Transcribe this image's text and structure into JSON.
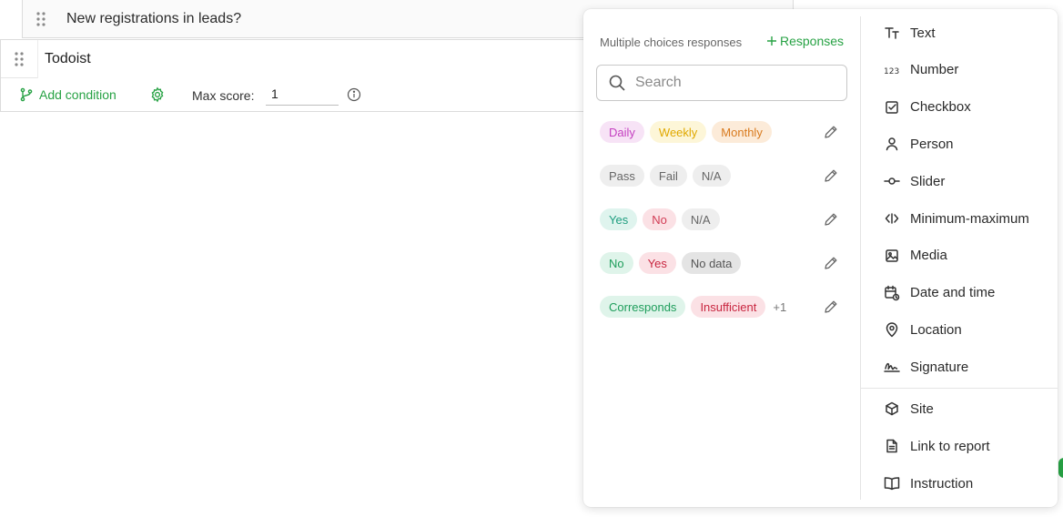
{
  "editor": {
    "previous_question": "New registrations in leads?",
    "current_question": "Todoist",
    "add_condition_label": "Add condition",
    "max_score_label": "Max score:",
    "max_score_value": "1"
  },
  "popover": {
    "header": "Multiple choices responses",
    "add_responses_label": "Responses",
    "search_placeholder": "Search",
    "response_sets": [
      {
        "chips": [
          {
            "label": "Daily",
            "bg": "#f7e3f6",
            "fg": "#c43fc0"
          },
          {
            "label": "Weekly",
            "bg": "#fdf6d8",
            "fg": "#e0a800"
          },
          {
            "label": "Monthly",
            "bg": "#fcebd9",
            "fg": "#d87a1e"
          }
        ],
        "more": ""
      },
      {
        "chips": [
          {
            "label": "Pass",
            "bg": "#eeeeee",
            "fg": "#666666"
          },
          {
            "label": "Fail",
            "bg": "#eeeeee",
            "fg": "#666666"
          },
          {
            "label": "N/A",
            "bg": "#eeeeee",
            "fg": "#666666"
          }
        ],
        "more": ""
      },
      {
        "chips": [
          {
            "label": "Yes",
            "bg": "#dff4ee",
            "fg": "#1f9e80"
          },
          {
            "label": "No",
            "bg": "#fbe1e5",
            "fg": "#d23c55"
          },
          {
            "label": "N/A",
            "bg": "#eeeeee",
            "fg": "#666666"
          }
        ],
        "more": ""
      },
      {
        "chips": [
          {
            "label": "No",
            "bg": "#dff4ea",
            "fg": "#1f9e5c"
          },
          {
            "label": "Yes",
            "bg": "#fbe1e5",
            "fg": "#c8253f"
          },
          {
            "label": "No data",
            "bg": "#e4e4e4",
            "fg": "#555555"
          }
        ],
        "more": ""
      },
      {
        "chips": [
          {
            "label": "Corresponds",
            "bg": "#dff4ea",
            "fg": "#1f9e5c"
          },
          {
            "label": "Insufficient",
            "bg": "#fbe1e5",
            "fg": "#c8253f"
          }
        ],
        "more": "+1"
      }
    ],
    "menu_items": [
      {
        "label": "Text",
        "icon": "text-type-icon"
      },
      {
        "label": "Number",
        "icon": "number-icon"
      },
      {
        "label": "Checkbox",
        "icon": "checkbox-icon"
      },
      {
        "label": "Person",
        "icon": "person-icon"
      },
      {
        "label": "Slider",
        "icon": "slider-icon"
      },
      {
        "label": "Minimum-maximum",
        "icon": "min-max-icon"
      },
      {
        "label": "Media",
        "icon": "media-icon"
      },
      {
        "label": "Date and time",
        "icon": "calendar-clock-icon"
      },
      {
        "label": "Location",
        "icon": "location-pin-icon"
      },
      {
        "label": "Signature",
        "icon": "signature-icon"
      }
    ],
    "menu_items_secondary": [
      {
        "label": "Site",
        "icon": "cube-icon"
      },
      {
        "label": "Link to report",
        "icon": "document-icon"
      },
      {
        "label": "Instruction",
        "icon": "book-icon"
      }
    ]
  },
  "colors": {
    "accent": "#27a244",
    "border": "#dcdcdc"
  }
}
